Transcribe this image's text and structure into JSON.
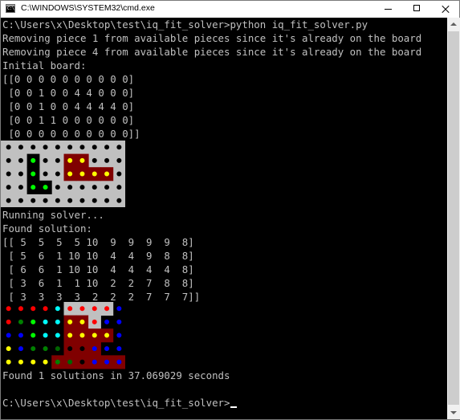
{
  "window": {
    "title": "C:\\WINDOWS\\SYSTEM32\\cmd.exe",
    "controls": [
      "minimize",
      "maximize",
      "close"
    ]
  },
  "console": {
    "lines_top": [
      "C:\\Users\\x\\Desktop\\test\\iq_fit_solver>python iq_fit_solver.py",
      "Removing piece 1 from available pieces since it's already on the board",
      "Removing piece 4 from available pieces since it's already on the board",
      "Initial board:",
      "[[0 0 0 0 0 0 0 0 0 0]",
      " [0 0 1 0 0 4 4 0 0 0]",
      " [0 0 1 0 0 4 4 4 4 0]",
      " [0 0 1 1 0 0 0 0 0 0]",
      " [0 0 0 0 0 0 0 0 0 0]]"
    ],
    "lines_middle": [
      "Running solver...",
      "Found solution:",
      "[[ 5  5  5  5 10  9  9  9  9  8]",
      " [ 5  6  1 10 10  4  4  9  8  8]",
      " [ 6  6  1 10 10  4  4  4  4  8]",
      " [ 3  6  1  1 10  2  2  7  8  8]",
      " [ 3  3  3  3  2  2  2  7  7  7]]"
    ],
    "lines_bottom": [
      "Found 1 solutions in 37.069029 seconds",
      "",
      "C:\\Users\\x\\Desktop\\test\\iq_fit_solver>"
    ]
  },
  "boards": {
    "initial": {
      "grid": [
        [
          0,
          0,
          0,
          0,
          0,
          0,
          0,
          0,
          0,
          0
        ],
        [
          0,
          0,
          1,
          0,
          0,
          4,
          4,
          0,
          0,
          0
        ],
        [
          0,
          0,
          1,
          0,
          0,
          4,
          4,
          4,
          4,
          0
        ],
        [
          0,
          0,
          1,
          1,
          0,
          0,
          0,
          0,
          0,
          0
        ],
        [
          0,
          0,
          0,
          0,
          0,
          0,
          0,
          0,
          0,
          0
        ]
      ],
      "background_color": "#c0c0c0",
      "empty_dot_color": "#000000"
    },
    "solution": {
      "grid": [
        [
          5,
          5,
          5,
          5,
          10,
          9,
          9,
          9,
          9,
          8
        ],
        [
          5,
          6,
          1,
          10,
          10,
          4,
          4,
          9,
          8,
          8
        ],
        [
          6,
          6,
          1,
          10,
          10,
          4,
          4,
          4,
          4,
          8
        ],
        [
          3,
          6,
          1,
          1,
          10,
          2,
          2,
          7,
          8,
          8
        ],
        [
          3,
          3,
          3,
          3,
          2,
          2,
          2,
          7,
          7,
          7
        ]
      ],
      "background_color": "#000000"
    },
    "piece_colors": {
      "1": {
        "bg": "#000000",
        "dot": "#00ff00"
      },
      "2": {
        "bg": "#800000",
        "dot": "#000000"
      },
      "3": {
        "bg": "#000000",
        "dot": "#ffff00"
      },
      "4": {
        "bg": "#800000",
        "dot": "#ffff00"
      },
      "5": {
        "bg": "#000000",
        "dot": "#ff0000"
      },
      "6": {
        "bg": "#000000",
        "dot": "#0000ff"
      },
      "7": {
        "bg": "#800000",
        "dot": "#0000ff"
      },
      "8": {
        "bg": "#000000",
        "dot": "#0000ff"
      },
      "9": {
        "bg": "#c0c0c0",
        "dot": "#ff0000"
      },
      "10": {
        "bg": "#000000",
        "dot": "#00ffff"
      }
    },
    "solution_dots": {
      "1": "#00ff00",
      "2": "#000000",
      "3": "#ffff00",
      "4": "#ffff00",
      "5": "#ff0000",
      "6": "#0000ff",
      "7": "#0000ff",
      "8": "#0000ff",
      "9": "#ff0000",
      "10": "#00ffff"
    },
    "solution_special": {
      "1,1": "#008000",
      "3,2": "#008000",
      "3,3": "#008000",
      "2,2": "#00ff00",
      "4,1": "#ffff00",
      "4,4": "#008000",
      "3,4": "#006400",
      "4,5": "#006400",
      "0,9": "#0000ff",
      "1,8": "#0000ff",
      "1,9": "#0000ff"
    }
  }
}
